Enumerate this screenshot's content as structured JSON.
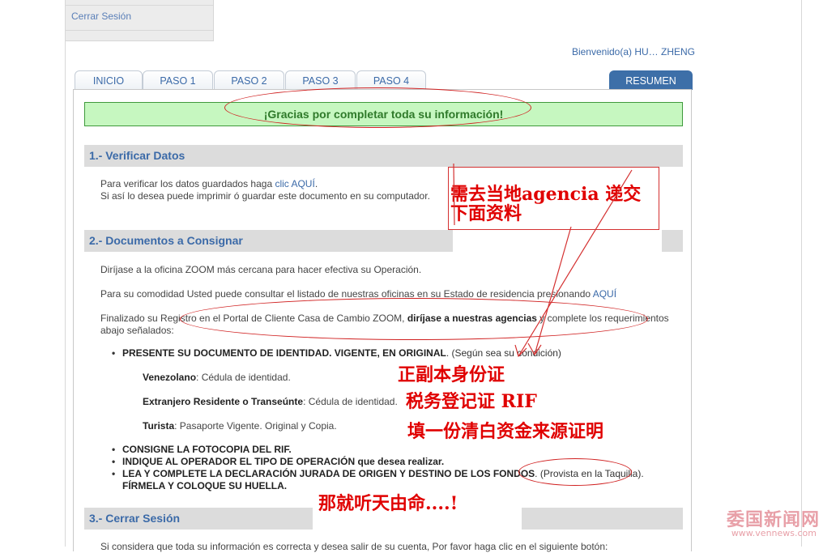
{
  "side_menu": {
    "logout_label": "Cerrar Sesión"
  },
  "welcome": "Bienvenido(a) HU… ZHENG",
  "tabs": [
    "INICIO",
    "PASO 1",
    "PASO 2",
    "PASO 3",
    "PASO 4",
    "RESUMEN"
  ],
  "notice": "¡Gracias por completar toda su información!",
  "sections": {
    "s1": {
      "title": "1.- Verificar Datos",
      "line1_pre": "Para verificar los datos guardados haga ",
      "line1_link": "clic AQUÍ",
      "line1_post": ".",
      "line2": "Si así lo desea puede imprimir ó guardar este documento en su computador."
    },
    "s2": {
      "title": "2.- Documentos a Consignar",
      "p1": "Diríjase a la oficina ZOOM más cercana para hacer efectiva su Operación.",
      "p2_pre": "Para su comodidad Usted puede consultar el listado de nuestras oficinas en su Estado de residencia presionando ",
      "p2_link": "AQUÍ",
      "p3_pre": "Finalizado su Registro en el Portal de Cliente Casa de Cambio ZOOM, ",
      "p3_bold": "diríjase a nuestras agencias",
      "p3_post": " y complete los requerimientos",
      "p3_line2": "abajo señalados:",
      "b1_bold": "PRESENTE SU DOCUMENTO DE IDENTIDAD. VIGENTE, EN ORIGINAL",
      "b1_post": ". (Según sea su condición)",
      "sub1_bold": "Venezolano",
      "sub1_post": ": Cédula de identidad.",
      "sub2_bold": "Extranjero Residente o Transeúnte",
      "sub2_post": ": Cédula de identidad.",
      "sub3_bold": "Turista",
      "sub3_post": ": Pasaporte Vigente. Original y Copia.",
      "b2": "CONSIGNE LA FOTOCOPIA DEL RIF.",
      "b3_bold": "INDIQUE AL OPERADOR EL TIPO DE OPERACIÓN",
      "b3_post": " que desea realizar.",
      "b4_bold": "LEA Y COMPLETE LA DECLARACIÓN JURADA DE ORIGEN Y DESTINO DE LOS FONDOS",
      "b4_post": ". (Provista en la Taquilla).",
      "b4_line2": "FÍRMELA Y COLOQUE SU HUELLA."
    },
    "s3": {
      "title": "3.- Cerrar Sesión",
      "p1": "Si considera que toda su información es correcta y desea salir de su cuenta, Por favor haga clic en el siguiente botón:"
    }
  },
  "annotations": {
    "agency_l1": "需去当地agencia 递交",
    "agency_l2": "下面资料",
    "id_card": "正副本身份证",
    "rif": "税务登记证 RIF",
    "funds": "填一份清白资金来源证明",
    "fate": "那就听天由命....!"
  },
  "watermark": {
    "text": "委国新闻网",
    "url": "www.vennews.com"
  },
  "colors": {
    "accent": "#3b6aa8",
    "notice_bg": "#c6f7c0",
    "annotation": "#e00000"
  }
}
